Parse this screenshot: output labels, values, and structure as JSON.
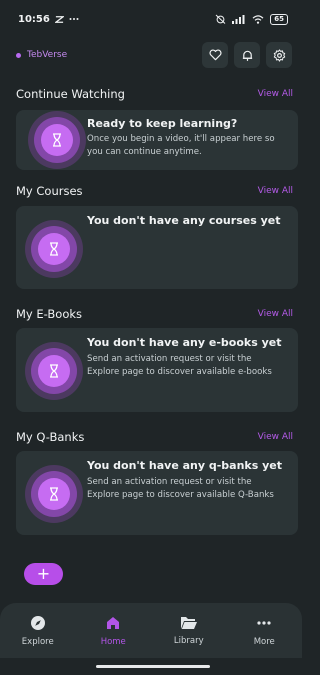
{
  "status": {
    "time": "10:56",
    "battery": "65"
  },
  "header": {
    "brand": "TebVerse"
  },
  "sections": {
    "continue": {
      "title": "Continue Watching",
      "view_all": "View All",
      "card_title": "Ready to keep learning?",
      "card_desc": "Once you begin a video, it'll appear here so you can continue anytime."
    },
    "courses": {
      "title": "My Courses",
      "view_all": "View All",
      "card_title": "You don't have any courses yet"
    },
    "ebooks": {
      "title": "My E-Books",
      "view_all": "View All",
      "card_title": "You don't have any e-books yet",
      "card_desc": "Send an activation request or visit the Explore page to discover available e-books"
    },
    "qbanks": {
      "title": "My Q-Banks",
      "view_all": "View All",
      "card_title": "You don't have any q-banks yet",
      "card_desc": "Send an activation request or visit the Explore page to discover available Q-Banks"
    }
  },
  "fab": {
    "label": "+"
  },
  "nav": {
    "items": [
      {
        "label": "Explore",
        "icon": "compass-icon"
      },
      {
        "label": "Home",
        "icon": "home-icon"
      },
      {
        "label": "Library",
        "icon": "folder-icon"
      },
      {
        "label": "More",
        "icon": "more-icon"
      }
    ]
  },
  "colors": {
    "background": "#1f2527",
    "card": "#2b3436",
    "accent": "#b74ee9"
  }
}
